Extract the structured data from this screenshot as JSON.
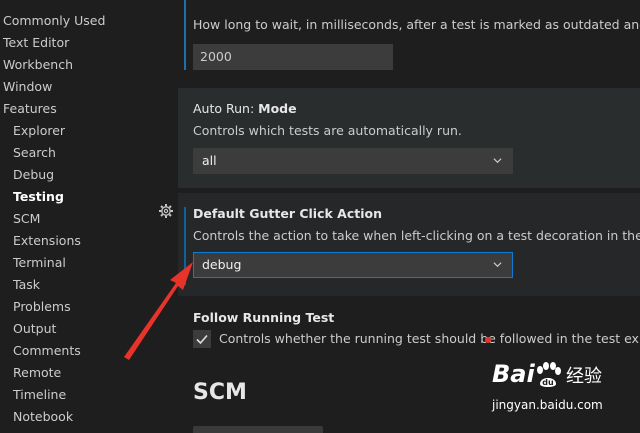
{
  "sidebar": {
    "items": [
      {
        "label": "Commonly Used",
        "indent": false,
        "active": false
      },
      {
        "label": "Text Editor",
        "indent": false,
        "active": false
      },
      {
        "label": "Workbench",
        "indent": false,
        "active": false
      },
      {
        "label": "Window",
        "indent": false,
        "active": false
      },
      {
        "label": "Features",
        "indent": false,
        "active": false
      },
      {
        "label": "Explorer",
        "indent": true,
        "active": false
      },
      {
        "label": "Search",
        "indent": true,
        "active": false
      },
      {
        "label": "Debug",
        "indent": true,
        "active": false
      },
      {
        "label": "Testing",
        "indent": true,
        "active": true
      },
      {
        "label": "SCM",
        "indent": true,
        "active": false
      },
      {
        "label": "Extensions",
        "indent": true,
        "active": false
      },
      {
        "label": "Terminal",
        "indent": true,
        "active": false
      },
      {
        "label": "Task",
        "indent": true,
        "active": false
      },
      {
        "label": "Problems",
        "indent": true,
        "active": false
      },
      {
        "label": "Output",
        "indent": true,
        "active": false
      },
      {
        "label": "Comments",
        "indent": true,
        "active": false
      },
      {
        "label": "Remote",
        "indent": true,
        "active": false
      },
      {
        "label": "Timeline",
        "indent": true,
        "active": false
      },
      {
        "label": "Notebook",
        "indent": true,
        "active": false
      }
    ]
  },
  "settings": {
    "outdated": {
      "description": "How long to wait, in milliseconds, after a test is marked as outdated and startin",
      "value": "2000"
    },
    "auto_run": {
      "category": "Auto Run: ",
      "name": "Mode",
      "description": "Controls which tests are automatically run.",
      "value": "all"
    },
    "gutter": {
      "name": "Default Gutter Click Action",
      "description": "Controls the action to take when left-clicking on a test decoration in the gutter",
      "value": "debug"
    },
    "follow": {
      "name": "Follow Running Test",
      "description": "Controls whether the running test should be followed in the test explorer",
      "checked": true
    },
    "next_section": "SCM"
  },
  "watermark": {
    "brand": "Bai",
    "brand_suffix": "经验",
    "url": "jingyan.baidu.com"
  },
  "colors": {
    "accent": "#0e639c",
    "annotation_arrow": "#e8332b"
  }
}
